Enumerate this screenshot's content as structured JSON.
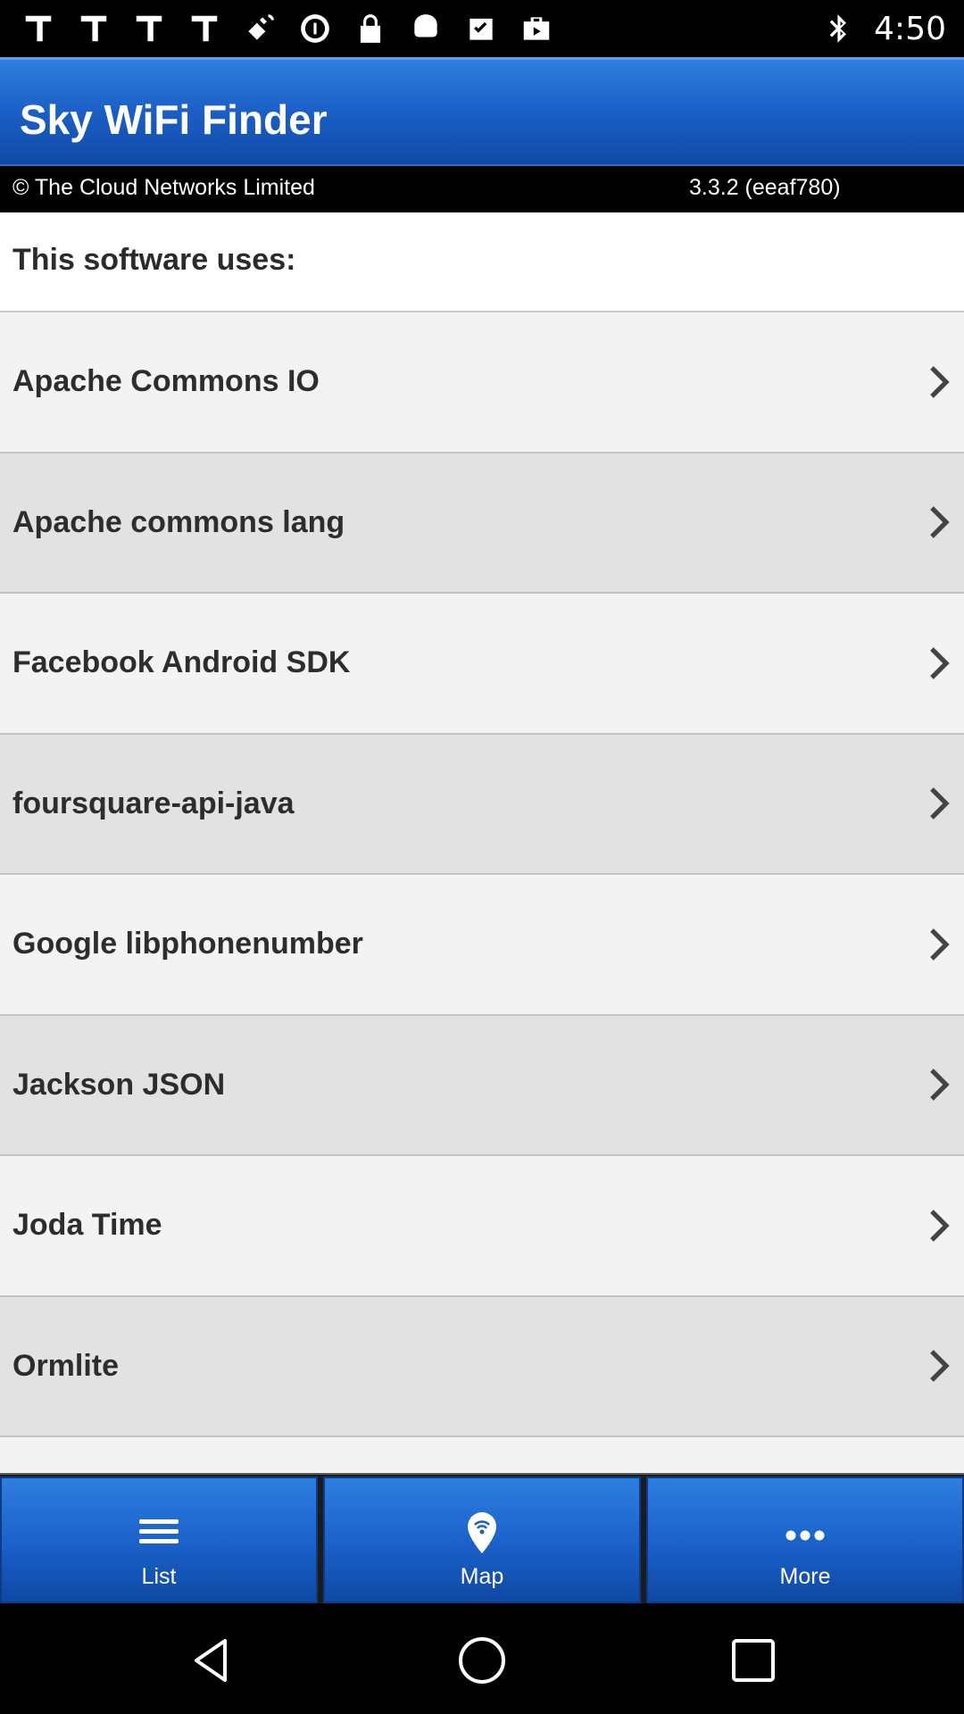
{
  "status_bar": {
    "time": "4:50",
    "left_icons": [
      "tape-icon",
      "tape-icon",
      "tape-icon",
      "tape-icon",
      "fake-gps-icon",
      "circle-icon",
      "lock-icon",
      "android-icon",
      "clipboard-check-icon",
      "bag-icon"
    ],
    "right_icons": [
      "bluetooth-icon"
    ]
  },
  "app": {
    "title": "Sky WiFi Finder",
    "copyright": "© The Cloud Networks Limited",
    "version": "3.3.2 (eeaf780)"
  },
  "content": {
    "heading": "This software uses:",
    "items": [
      {
        "label": "Apache Commons IO"
      },
      {
        "label": "Apache commons lang"
      },
      {
        "label": "Facebook Android SDK"
      },
      {
        "label": "foursquare-api-java"
      },
      {
        "label": "Google libphonenumber"
      },
      {
        "label": "Jackson JSON"
      },
      {
        "label": "Joda Time"
      },
      {
        "label": "Ormlite"
      }
    ]
  },
  "tabs": [
    {
      "label": "List",
      "icon": "list-icon"
    },
    {
      "label": "Map",
      "icon": "map-pin-icon"
    },
    {
      "label": "More",
      "icon": "more-icon"
    }
  ],
  "nav": {
    "buttons": [
      "back-icon",
      "home-icon",
      "recents-icon"
    ]
  }
}
